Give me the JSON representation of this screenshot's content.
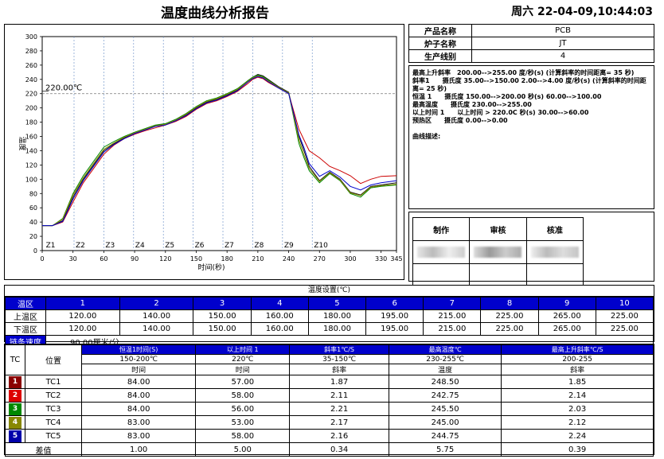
{
  "header": {
    "title": "温度曲线分析报告",
    "datetime": "周六 22-04-09,10:44:03"
  },
  "info": [
    {
      "key": "产品名称",
      "value": "PCB"
    },
    {
      "key": "炉子名称",
      "value": "JT"
    },
    {
      "key": "生产线别",
      "value": "4"
    }
  ],
  "params": [
    "最高上升斜率　200.00-->255.00 度/秒(s) (计算斜率的时间距离= 35 秒)",
    "斜率1　　摄氏度 35.00-->150.00 2.00-->4.00 度/秒(s) (计算斜率的时间距离= 25 秒)",
    "恒温 1　　摄氏度 150.00-->200.00 秒(s) 60.00-->100.00",
    "最高温度　　摄氏度 230.00-->255.00",
    "以上时间 1　　以上时间 > 220.0C 秒(s) 30.00-->60.00",
    "预热区　　摄氏度 0.00-->0.00",
    "",
    "曲线描述:"
  ],
  "signoff": [
    "制作",
    "审核",
    "核准"
  ],
  "chart_data": {
    "type": "line",
    "ylabel": "温度",
    "xlabel": "时间(秒)",
    "xlim": [
      0,
      345
    ],
    "ylim": [
      0,
      300
    ],
    "xticks": [
      0,
      30,
      60,
      90,
      120,
      150,
      180,
      210,
      240,
      270,
      300,
      330,
      345
    ],
    "yticks": [
      0,
      20,
      40,
      60,
      80,
      100,
      120,
      140,
      160,
      180,
      200,
      220,
      240,
      260,
      280,
      300
    ],
    "ref_line": {
      "y": 220,
      "label": "220.00℃"
    },
    "zone_labels": [
      {
        "x": 2,
        "label": "Z1"
      },
      {
        "x": 31,
        "label": "Z2"
      },
      {
        "x": 60,
        "label": "Z3"
      },
      {
        "x": 89,
        "label": "Z4"
      },
      {
        "x": 118,
        "label": "Z5"
      },
      {
        "x": 147,
        "label": "Z6"
      },
      {
        "x": 176,
        "label": "Z7"
      },
      {
        "x": 205,
        "label": "Z8"
      },
      {
        "x": 234,
        "label": "Z9"
      },
      {
        "x": 263,
        "label": "Z10"
      }
    ],
    "series": [
      {
        "name": "TC1",
        "color": "#111111",
        "x": [
          0,
          10,
          20,
          30,
          40,
          50,
          60,
          70,
          80,
          90,
          100,
          110,
          120,
          130,
          140,
          150,
          160,
          170,
          180,
          190,
          200,
          205,
          210,
          215,
          220,
          230,
          240,
          250,
          255,
          260,
          270,
          280,
          290,
          300,
          310,
          320,
          330,
          345
        ],
        "y": [
          35,
          35,
          42,
          75,
          100,
          120,
          140,
          150,
          158,
          165,
          170,
          175,
          177,
          182,
          190,
          200,
          208,
          212,
          218,
          225,
          238,
          243,
          247,
          245,
          240,
          230,
          222,
          160,
          140,
          118,
          98,
          110,
          100,
          82,
          78,
          90,
          92,
          95
        ]
      },
      {
        "name": "TC2",
        "color": "#cc0000",
        "x": [
          0,
          10,
          20,
          30,
          40,
          50,
          60,
          70,
          80,
          90,
          100,
          110,
          120,
          130,
          140,
          150,
          160,
          170,
          180,
          190,
          200,
          205,
          210,
          215,
          220,
          230,
          240,
          250,
          255,
          260,
          270,
          280,
          290,
          300,
          310,
          320,
          330,
          345
        ],
        "y": [
          35,
          35,
          40,
          68,
          95,
          115,
          135,
          148,
          157,
          163,
          168,
          172,
          176,
          181,
          188,
          198,
          206,
          210,
          216,
          223,
          234,
          240,
          243,
          241,
          236,
          228,
          220,
          170,
          155,
          140,
          130,
          118,
          112,
          105,
          94,
          100,
          104,
          105
        ]
      },
      {
        "name": "TC3",
        "color": "#008800",
        "x": [
          0,
          10,
          20,
          30,
          40,
          50,
          60,
          70,
          80,
          90,
          100,
          110,
          120,
          130,
          140,
          150,
          160,
          170,
          180,
          190,
          200,
          205,
          210,
          215,
          220,
          230,
          240,
          250,
          255,
          260,
          270,
          280,
          290,
          300,
          310,
          320,
          330,
          345
        ],
        "y": [
          35,
          35,
          45,
          80,
          105,
          125,
          145,
          153,
          160,
          166,
          171,
          176,
          178,
          184,
          192,
          202,
          210,
          214,
          220,
          227,
          238,
          243,
          246,
          244,
          239,
          229,
          221,
          150,
          130,
          112,
          95,
          108,
          98,
          80,
          75,
          88,
          90,
          92
        ]
      },
      {
        "name": "TC4",
        "color": "#888800",
        "x": [
          0,
          10,
          20,
          30,
          40,
          50,
          60,
          70,
          80,
          90,
          100,
          110,
          120,
          130,
          140,
          150,
          160,
          170,
          180,
          190,
          200,
          205,
          210,
          215,
          220,
          230,
          240,
          250,
          255,
          260,
          270,
          280,
          290,
          300,
          310,
          320,
          330,
          345
        ],
        "y": [
          35,
          35,
          44,
          78,
          102,
          122,
          142,
          151,
          159,
          165,
          170,
          175,
          177,
          183,
          191,
          201,
          209,
          213,
          219,
          226,
          237,
          242,
          245,
          243,
          238,
          229,
          221,
          155,
          134,
          115,
          97,
          109,
          99,
          81,
          77,
          89,
          91,
          93
        ]
      },
      {
        "name": "TC5",
        "color": "#0000cc",
        "x": [
          0,
          10,
          20,
          30,
          40,
          50,
          60,
          70,
          80,
          90,
          100,
          110,
          120,
          130,
          140,
          150,
          160,
          170,
          180,
          190,
          200,
          205,
          210,
          215,
          220,
          230,
          240,
          250,
          255,
          260,
          270,
          280,
          290,
          300,
          310,
          320,
          330,
          345
        ],
        "y": [
          35,
          35,
          41,
          72,
          98,
          118,
          138,
          149,
          157,
          164,
          169,
          174,
          176,
          182,
          189,
          199,
          207,
          211,
          217,
          224,
          236,
          241,
          244,
          242,
          237,
          228,
          220,
          162,
          144,
          122,
          104,
          112,
          103,
          90,
          85,
          92,
          95,
          98
        ]
      }
    ]
  },
  "zones": {
    "caption": "温度设置(℃)",
    "head_label": "温区",
    "numbers": [
      "1",
      "2",
      "3",
      "4",
      "5",
      "6",
      "7",
      "8",
      "9",
      "10"
    ],
    "rows": [
      {
        "label": "上温区",
        "values": [
          "120.00",
          "140.00",
          "150.00",
          "160.00",
          "180.00",
          "195.00",
          "215.00",
          "225.00",
          "265.00",
          "225.00"
        ]
      },
      {
        "label": "下温区",
        "values": [
          "120.00",
          "140.00",
          "150.00",
          "160.00",
          "180.00",
          "195.00",
          "215.00",
          "225.00",
          "265.00",
          "225.00"
        ]
      }
    ],
    "speed_label": "链条速度",
    "speed_value": "90.00厘米/分"
  },
  "tc_table": {
    "tc_label": "TC",
    "pos_label": "位置",
    "groups": [
      {
        "title": "恒温1时间(S)",
        "range": "150-200℃",
        "sub": "时间"
      },
      {
        "title": "以上时间 1",
        "range": "220℃",
        "sub": "时间"
      },
      {
        "title": "斜率1℃/S",
        "range": "35-150℃",
        "sub": "斜率"
      },
      {
        "title": "最高温度℃",
        "range": "230-255℃",
        "sub": "温度"
      },
      {
        "title": "最高上升斜率℃/S",
        "range": "200-255",
        "sub": "斜率"
      }
    ],
    "rows": [
      {
        "num": "1",
        "color": "#8b0000",
        "name": "TC1",
        "values": [
          "84.00",
          "57.00",
          "1.87",
          "248.50",
          "1.85"
        ]
      },
      {
        "num": "2",
        "color": "#dd0000",
        "name": "TC2",
        "values": [
          "84.00",
          "58.00",
          "2.11",
          "242.75",
          "2.14"
        ]
      },
      {
        "num": "3",
        "color": "#008800",
        "name": "TC3",
        "values": [
          "84.00",
          "56.00",
          "2.21",
          "245.50",
          "2.03"
        ]
      },
      {
        "num": "4",
        "color": "#888800",
        "name": "TC4",
        "values": [
          "83.00",
          "53.00",
          "2.17",
          "245.00",
          "2.12"
        ]
      },
      {
        "num": "5",
        "color": "#0000aa",
        "name": "TC5",
        "values": [
          "83.00",
          "58.00",
          "2.16",
          "244.75",
          "2.24"
        ]
      }
    ],
    "diff_label": "差值",
    "diff": [
      "1.00",
      "5.00",
      "0.34",
      "5.75",
      "0.39"
    ]
  }
}
